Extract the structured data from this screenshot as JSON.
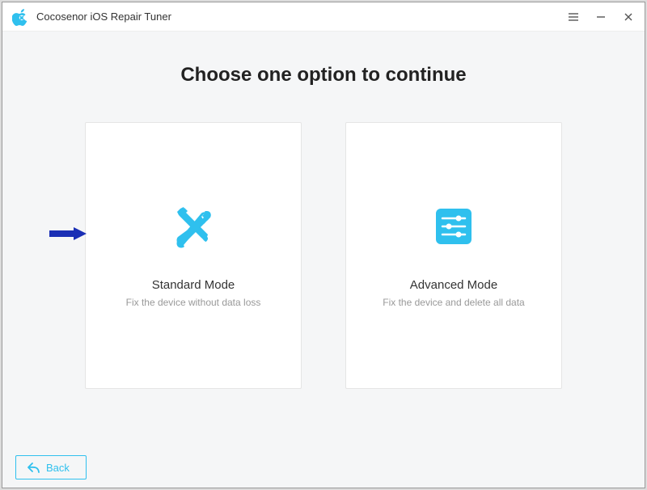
{
  "app": {
    "title": "Cocosenor iOS Repair Tuner"
  },
  "main": {
    "heading": "Choose one option to continue",
    "options": [
      {
        "title": "Standard Mode",
        "subtitle": "Fix the device without data loss",
        "icon": "wrench-screwdriver-icon"
      },
      {
        "title": "Advanced Mode",
        "subtitle": "Fix the device and delete all data",
        "icon": "sliders-icon"
      }
    ]
  },
  "footer": {
    "back_label": "Back"
  },
  "colors": {
    "accent": "#2fc0ee",
    "annotation_arrow": "#1a2fb5"
  }
}
